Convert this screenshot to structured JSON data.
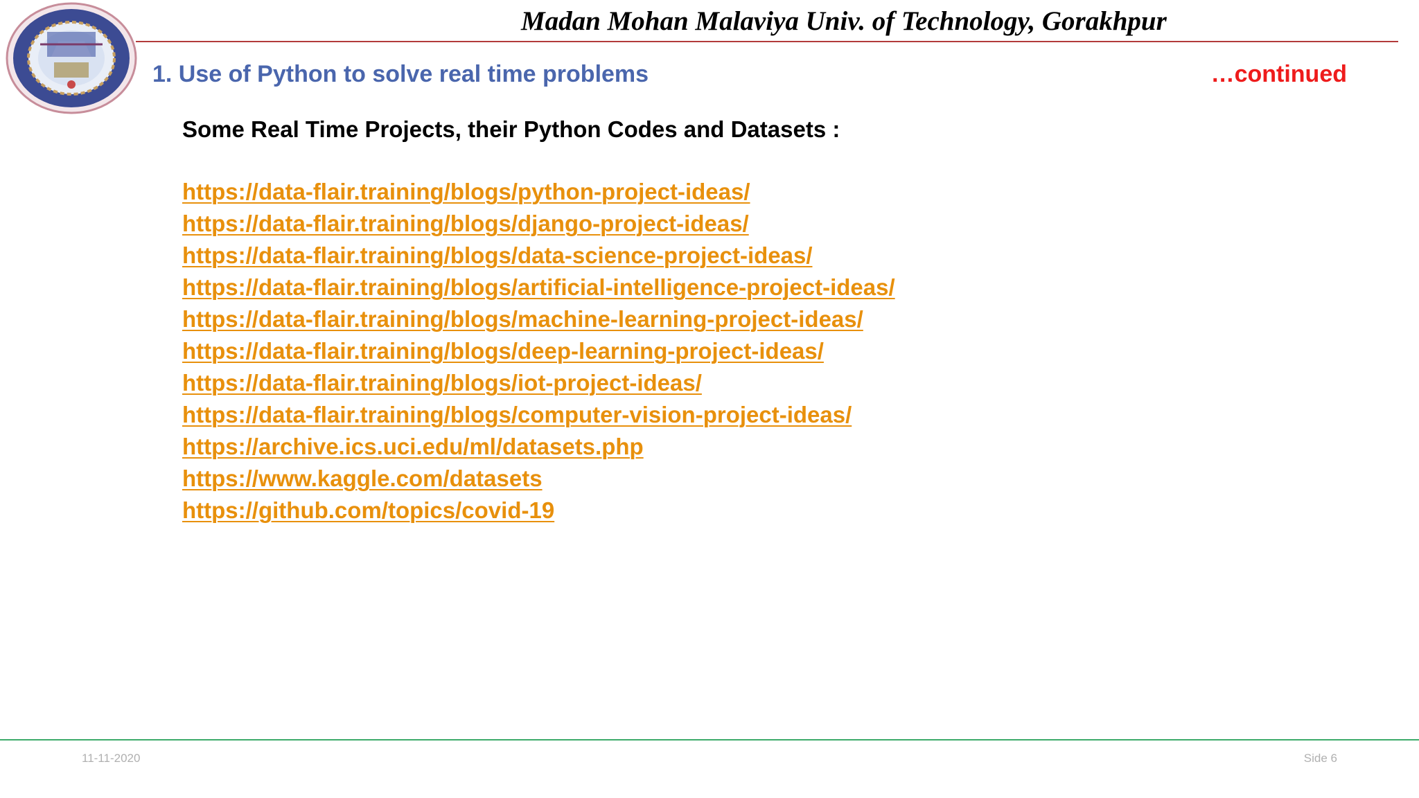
{
  "header": {
    "university": "Madan Mohan Malaviya Univ. of Technology, Gorakhpur",
    "logo_icon": "university-seal-icon"
  },
  "section": {
    "title": "1. Use of Python to solve real time problems",
    "continued": "…continued"
  },
  "content": {
    "subheading": "Some Real Time Projects, their Python Codes and Datasets :",
    "links": [
      "https://data-flair.training/blogs/python-project-ideas/",
      "https://data-flair.training/blogs/django-project-ideas/",
      "https://data-flair.training/blogs/data-science-project-ideas/",
      "https://data-flair.training/blogs/artificial-intelligence-project-ideas/",
      "https://data-flair.training/blogs/machine-learning-project-ideas/",
      "https://data-flair.training/blogs/deep-learning-project-ideas/",
      "https://data-flair.training/blogs/iot-project-ideas/",
      "https://data-flair.training/blogs/computer-vision-project-ideas/",
      "https://archive.ics.uci.edu/ml/datasets.php",
      "https://www.kaggle.com/datasets",
      "https://github.com/topics/covid-19"
    ]
  },
  "footer": {
    "date": "11-11-2020",
    "slide": "Side 6"
  },
  "colors": {
    "title_blue": "#4a66ad",
    "continued_red": "#ee1c1c",
    "link_orange": "#e8900c",
    "header_rule": "#b23a3a",
    "footer_rule": "#3cab6a"
  }
}
